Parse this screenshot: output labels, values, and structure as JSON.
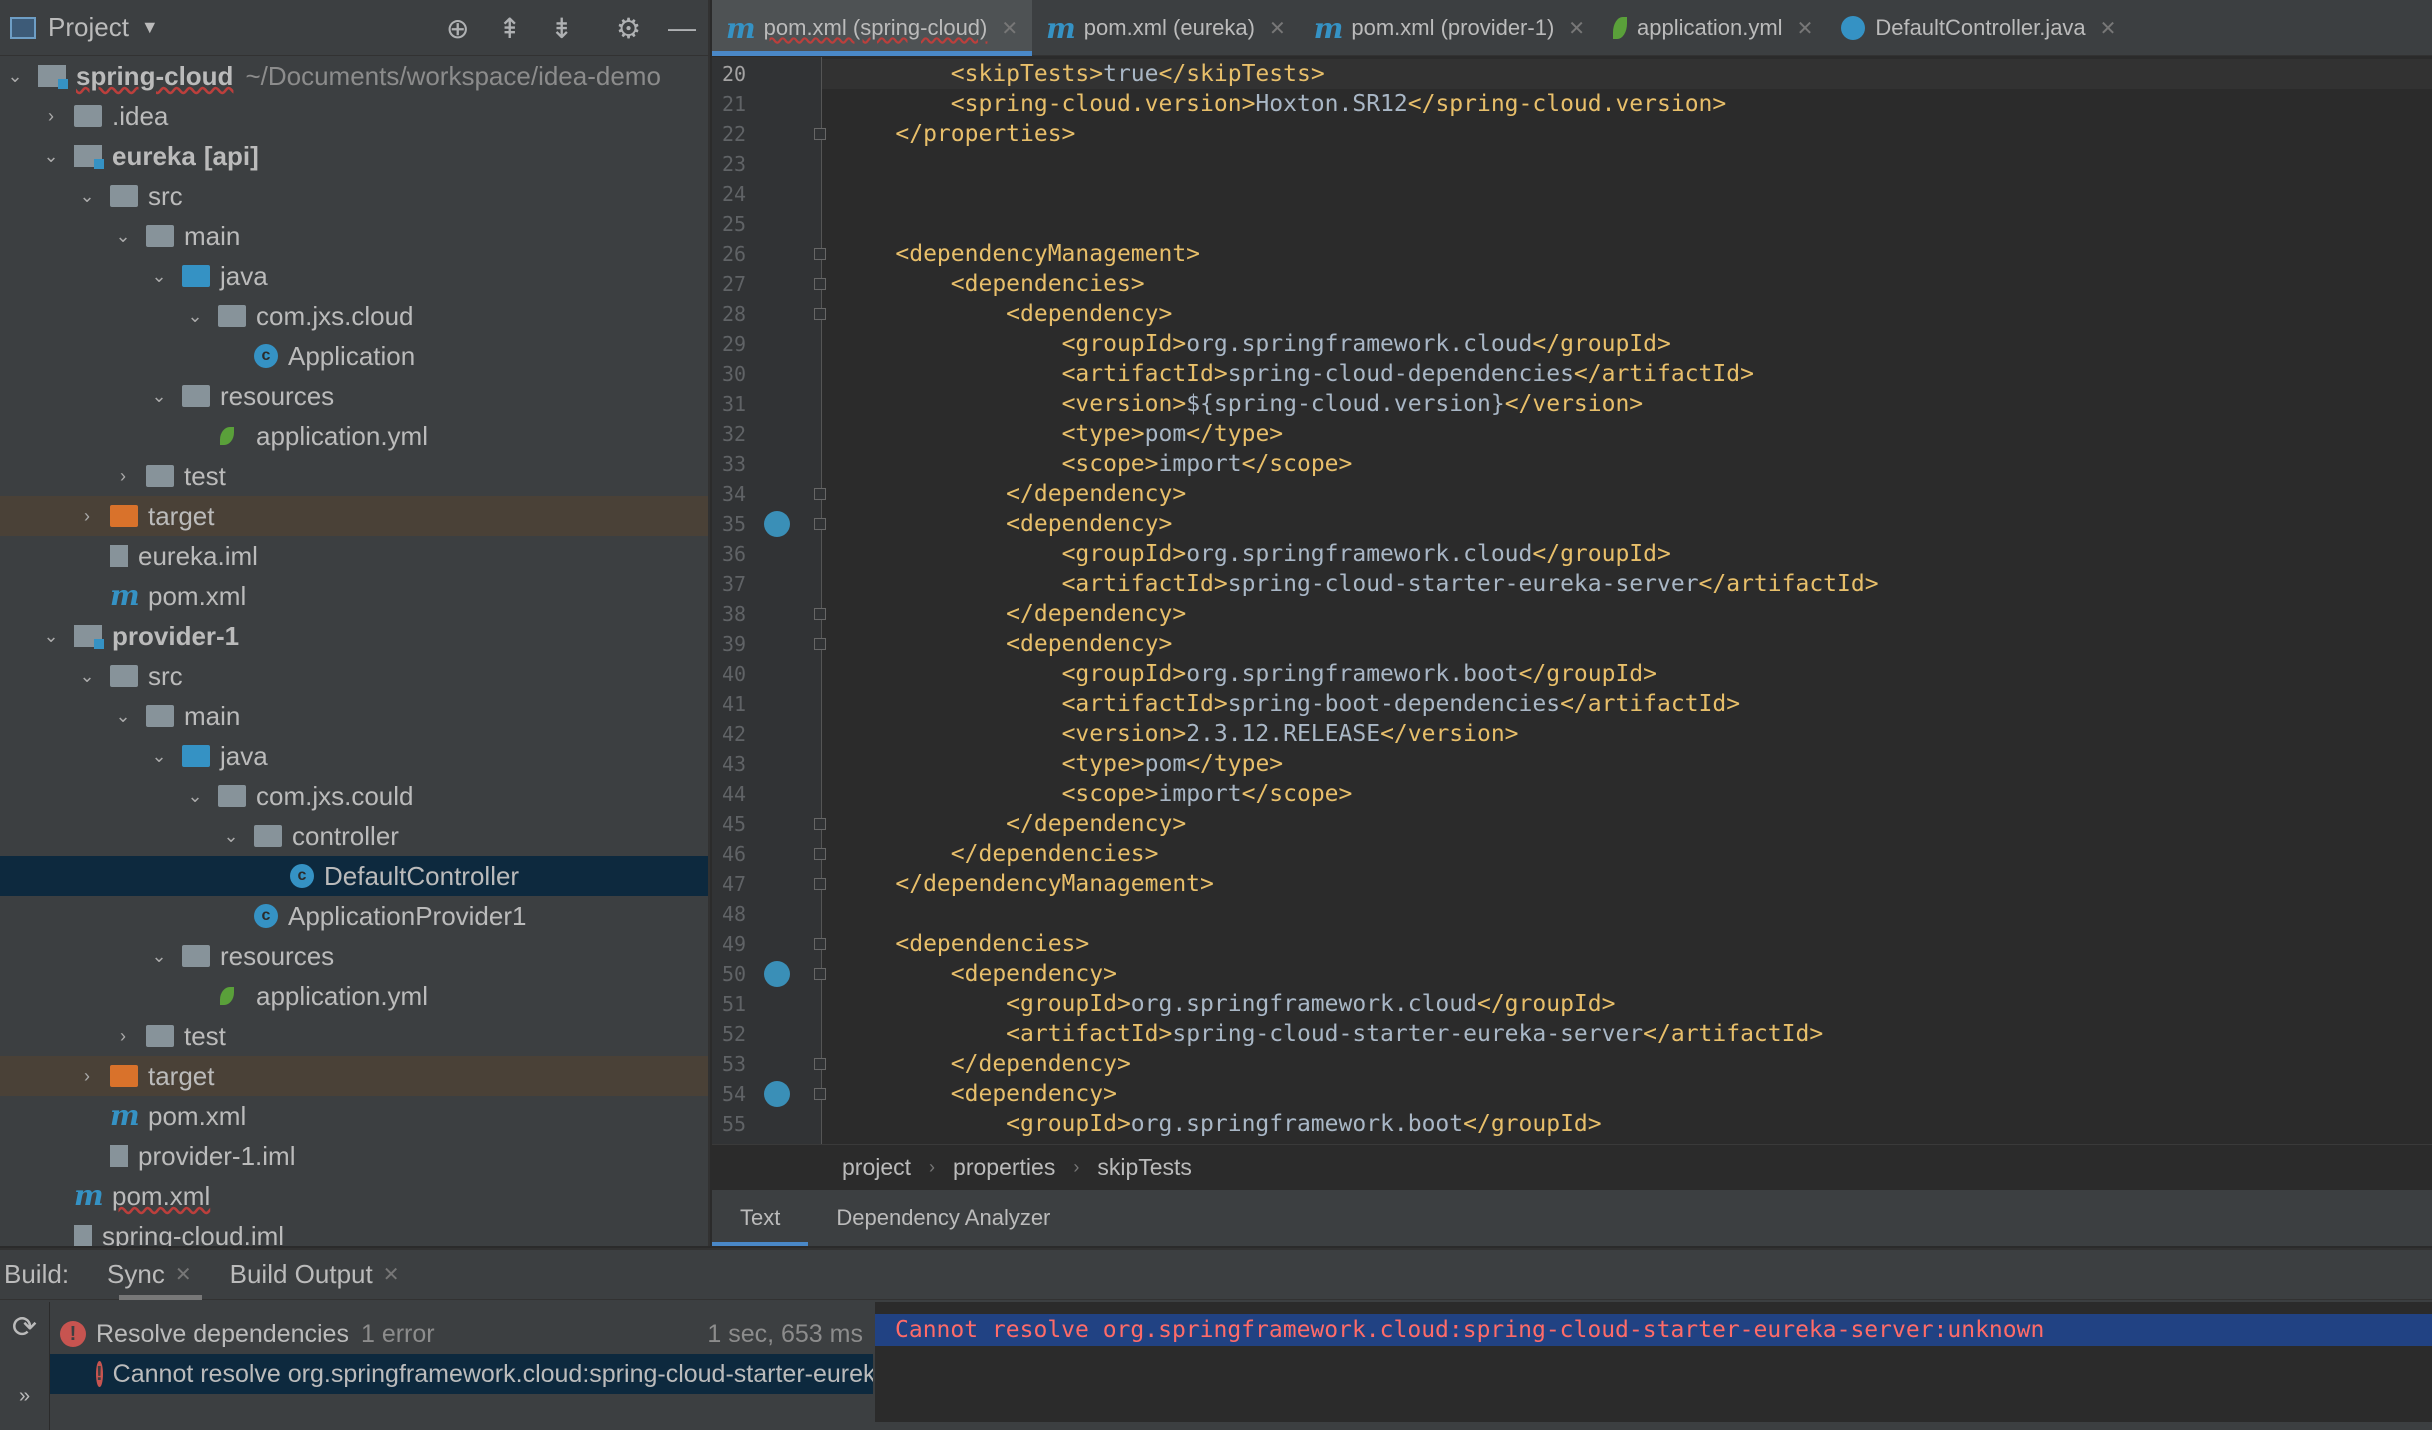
{
  "project": {
    "title": "Project",
    "tree": [
      {
        "label": "spring-cloud",
        "extra": "~/Documents/workspace/idea-demo",
        "level": 0,
        "icon": "module",
        "chev": "down",
        "bold": true,
        "squig": true
      },
      {
        "label": ".idea",
        "level": 1,
        "icon": "folder",
        "chev": "right"
      },
      {
        "label": "eureka",
        "extra": "[api]",
        "level": 1,
        "icon": "module",
        "chev": "down",
        "bold": true
      },
      {
        "label": "src",
        "level": 2,
        "icon": "folder",
        "chev": "down"
      },
      {
        "label": "main",
        "level": 3,
        "icon": "folder",
        "chev": "down"
      },
      {
        "label": "java",
        "level": 4,
        "icon": "folder-blue",
        "chev": "down"
      },
      {
        "label": "com.jxs.cloud",
        "level": 5,
        "icon": "package",
        "chev": "down"
      },
      {
        "label": "Application",
        "level": 6,
        "icon": "class"
      },
      {
        "label": "resources",
        "level": 4,
        "icon": "folder",
        "chev": "down"
      },
      {
        "label": "application.yml",
        "level": 5,
        "icon": "yml"
      },
      {
        "label": "test",
        "level": 3,
        "icon": "folder",
        "chev": "right"
      },
      {
        "label": "target",
        "level": 2,
        "icon": "folder-orange",
        "chev": "right",
        "target": true
      },
      {
        "label": "eureka.iml",
        "level": 2,
        "icon": "iml"
      },
      {
        "label": "pom.xml",
        "level": 2,
        "icon": "maven"
      },
      {
        "label": "provider-1",
        "level": 1,
        "icon": "module",
        "chev": "down",
        "bold": true
      },
      {
        "label": "src",
        "level": 2,
        "icon": "folder",
        "chev": "down"
      },
      {
        "label": "main",
        "level": 3,
        "icon": "folder",
        "chev": "down"
      },
      {
        "label": "java",
        "level": 4,
        "icon": "folder-blue",
        "chev": "down"
      },
      {
        "label": "com.jxs.could",
        "level": 5,
        "icon": "package",
        "chev": "down"
      },
      {
        "label": "controller",
        "level": 6,
        "icon": "package",
        "chev": "down"
      },
      {
        "label": "DefaultController",
        "level": 7,
        "icon": "class",
        "selected": true
      },
      {
        "label": "ApplicationProvider1",
        "level": 6,
        "icon": "class"
      },
      {
        "label": "resources",
        "level": 4,
        "icon": "folder",
        "chev": "down"
      },
      {
        "label": "application.yml",
        "level": 5,
        "icon": "yml"
      },
      {
        "label": "test",
        "level": 3,
        "icon": "folder",
        "chev": "right"
      },
      {
        "label": "target",
        "level": 2,
        "icon": "folder-orange",
        "chev": "right",
        "target": true
      },
      {
        "label": "pom.xml",
        "level": 2,
        "icon": "maven"
      },
      {
        "label": "provider-1.iml",
        "level": 2,
        "icon": "iml"
      },
      {
        "label": "pom.xml",
        "level": 1,
        "icon": "maven",
        "squig": true
      },
      {
        "label": "spring-cloud.iml",
        "level": 1,
        "icon": "iml"
      }
    ]
  },
  "tabs": [
    {
      "label": "pom.xml (spring-cloud)",
      "icon": "maven",
      "active": true
    },
    {
      "label": "pom.xml (eureka)",
      "icon": "maven"
    },
    {
      "label": "pom.xml (provider-1)",
      "icon": "maven"
    },
    {
      "label": "application.yml",
      "icon": "yml"
    },
    {
      "label": "DefaultController.java",
      "icon": "class"
    }
  ],
  "editor": {
    "first_line": 20,
    "current_line": 20,
    "lines": [
      "        <skipTests>true</skipTests>",
      "        <spring-cloud.version>Hoxton.SR12</spring-cloud.version>",
      "    </properties>",
      "",
      "",
      "",
      "    <dependencyManagement>",
      "        <dependencies>",
      "            <dependency>",
      "                <groupId>org.springframework.cloud</groupId>",
      "                <artifactId>spring-cloud-dependencies</artifactId>",
      "                <version>${spring-cloud.version}</version>",
      "                <type>pom</type>",
      "                <scope>import</scope>",
      "            </dependency>",
      "            <dependency>",
      "                <groupId>org.springframework.cloud</groupId>",
      "                <artifactId>spring-cloud-starter-eureka-server</artifactId>",
      "            </dependency>",
      "            <dependency>",
      "                <groupId>org.springframework.boot</groupId>",
      "                <artifactId>spring-boot-dependencies</artifactId>",
      "                <version>2.3.12.RELEASE</version>",
      "                <type>pom</type>",
      "                <scope>import</scope>",
      "            </dependency>",
      "        </dependencies>",
      "    </dependencyManagement>",
      "",
      "    <dependencies>",
      "        <dependency>",
      "            <groupId>org.springframework.cloud</groupId>",
      "            <artifactId>spring-cloud-starter-eureka-server</artifactId>",
      "        </dependency>",
      "        <dependency>",
      "            <groupId>org.springframework.boot</groupId>"
    ],
    "fold_lines": [
      22,
      26,
      27,
      28,
      34,
      35,
      38,
      39,
      45,
      46,
      47,
      49,
      50,
      53,
      54
    ],
    "gutter_icon_lines": [
      35,
      50,
      54
    ]
  },
  "breadcrumb": [
    "project",
    "properties",
    "skipTests"
  ],
  "bottom_tabs": [
    {
      "label": "Text",
      "active": true
    },
    {
      "label": "Dependency Analyzer"
    }
  ],
  "build": {
    "label": "Build:",
    "tabs": [
      {
        "label": "Sync",
        "active": true
      },
      {
        "label": "Build Output"
      }
    ],
    "rows": [
      {
        "label": "Resolve dependencies",
        "count": "1 error",
        "time": "1 sec, 653 ms"
      },
      {
        "label": "Cannot resolve org.springframework.cloud:spring-cloud-starter-eureka-server:unknown",
        "selected": true
      }
    ],
    "output": "Cannot resolve org.springframework.cloud:spring-cloud-starter-eureka-server:unknown"
  },
  "colors": {
    "accent": "#4a88c7",
    "tag": "#e8bf6a",
    "error": "#ff6b68"
  }
}
